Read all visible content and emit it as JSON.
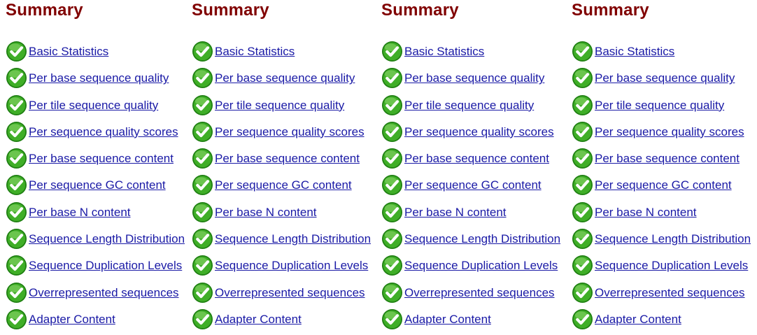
{
  "icon": "pass-check-icon",
  "colors": {
    "heading": "#800000",
    "link": "#1a1aa6",
    "check_green": "#2e9a1e"
  },
  "panels": [
    {
      "title": "Summary",
      "items": [
        "Basic Statistics",
        "Per base sequence quality",
        "Per tile sequence quality",
        "Per sequence quality scores",
        "Per base sequence content",
        "Per sequence GC content",
        "Per base N content",
        "Sequence Length Distribution",
        "Sequence Duplication Levels",
        "Overrepresented sequences",
        "Adapter Content"
      ]
    },
    {
      "title": "Summary",
      "items": [
        "Basic Statistics",
        "Per base sequence quality",
        "Per tile sequence quality",
        "Per sequence quality scores",
        "Per base sequence content",
        "Per sequence GC content",
        "Per base N content",
        "Sequence Length Distribution",
        "Sequence Duplication Levels",
        "Overrepresented sequences",
        "Adapter Content"
      ]
    },
    {
      "title": "Summary",
      "items": [
        "Basic Statistics",
        "Per base sequence quality",
        "Per tile sequence quality",
        "Per sequence quality scores",
        "Per base sequence content",
        "Per sequence GC content",
        "Per base N content",
        "Sequence Length Distribution",
        "Sequence Duplication Levels",
        "Overrepresented sequences",
        "Adapter Content"
      ]
    },
    {
      "title": "Summary",
      "items": [
        "Basic Statistics",
        "Per base sequence quality",
        "Per tile sequence quality",
        "Per sequence quality scores",
        "Per base sequence content",
        "Per sequence GC content",
        "Per base N content",
        "Sequence Length Distribution",
        "Sequence Duplication Levels",
        "Overrepresented sequences",
        "Adapter Content"
      ]
    }
  ]
}
